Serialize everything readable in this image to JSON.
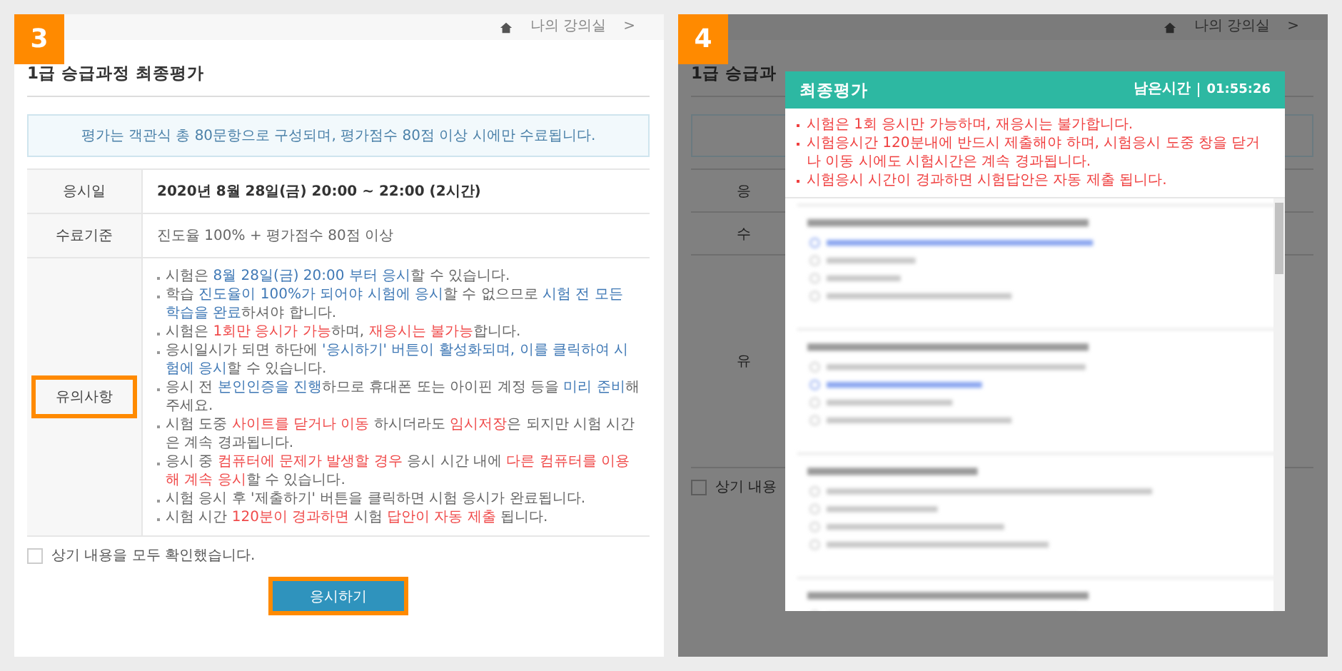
{
  "step_3": {
    "badge": "3",
    "breadcrumb": {
      "label": "나의 강의실",
      "separator": ">"
    },
    "title": "1급 승급과정 최종평가",
    "notice": "평가는 객관식 총 80문항으로 구성되며, 평가점수 80점 이상 시에만 수료됩니다.",
    "rows": [
      {
        "label": "응시일",
        "kind": "strong",
        "value": "2020년 8월 28일(금) 20:00 ~ 22:00 (2시간)"
      },
      {
        "label": "수료기준",
        "kind": "plain",
        "value": "진도율 100% + 평가점수 80점 이상"
      },
      {
        "label": "유의사항",
        "kind": "notes",
        "highlighted": true,
        "notes": [
          [
            {
              "text": "시험은 ",
              "kind": "normal"
            },
            {
              "text": "8월 28일(금) 20:00 부터 응시",
              "kind": "info"
            },
            {
              "text": "할 수 있습니다.",
              "kind": "normal"
            }
          ],
          [
            {
              "text": "학습 ",
              "kind": "normal"
            },
            {
              "text": "진도율이 100%가 되어야 시험에 응시",
              "kind": "info"
            },
            {
              "text": "할 수 없으므로 ",
              "kind": "normal"
            },
            {
              "text": "시험 전 모든 학습을 완료",
              "kind": "info"
            },
            {
              "text": "하셔야 합니다.",
              "kind": "normal"
            }
          ],
          [
            {
              "text": "시험은 ",
              "kind": "normal"
            },
            {
              "text": "1회만 응시가 가능",
              "kind": "warning"
            },
            {
              "text": "하며, ",
              "kind": "normal"
            },
            {
              "text": "재응시는 불가능",
              "kind": "warning"
            },
            {
              "text": "합니다.",
              "kind": "normal"
            }
          ],
          [
            {
              "text": "응시일시가 되면 하단에 ",
              "kind": "normal"
            },
            {
              "text": "'응시하기' 버튼이 활성화되며, 이를 클릭하여 시험에 응시",
              "kind": "info"
            },
            {
              "text": "할 수 있습니다.",
              "kind": "normal"
            }
          ],
          [
            {
              "text": "응시 전 ",
              "kind": "normal"
            },
            {
              "text": "본인인증을 진행",
              "kind": "info"
            },
            {
              "text": "하므로 휴대폰 또는 아이핀 계정 등을 ",
              "kind": "normal"
            },
            {
              "text": "미리 준비",
              "kind": "info"
            },
            {
              "text": "해 주세요.",
              "kind": "normal"
            }
          ],
          [
            {
              "text": "시험 도중 ",
              "kind": "normal"
            },
            {
              "text": "사이트를 닫거나 이동",
              "kind": "warning"
            },
            {
              "text": " 하시더라도 ",
              "kind": "normal"
            },
            {
              "text": "임시저장",
              "kind": "warning"
            },
            {
              "text": "은 되지만 시험 시간은 계속 경과됩니다.",
              "kind": "normal"
            }
          ],
          [
            {
              "text": "응시 중 ",
              "kind": "normal"
            },
            {
              "text": "컴퓨터에 문제가 발생할 경우",
              "kind": "warning"
            },
            {
              "text": " 응시 시간 내에 ",
              "kind": "normal"
            },
            {
              "text": "다른 컴퓨터를 이용해 계속 응시",
              "kind": "warning"
            },
            {
              "text": "할 수 있습니다.",
              "kind": "normal"
            }
          ],
          [
            {
              "text": "시험 응시 후 '제출하기' 버튼을 클릭하면 시험 응시가 완료됩니다.",
              "kind": "normal"
            }
          ],
          [
            {
              "text": "시험 시간 ",
              "kind": "normal"
            },
            {
              "text": "120분이 경과하면",
              "kind": "warning"
            },
            {
              "text": " 시험 ",
              "kind": "normal"
            },
            {
              "text": "답안이 자동 제출",
              "kind": "warning"
            },
            {
              "text": " 됩니다.",
              "kind": "normal"
            }
          ]
        ]
      }
    ],
    "confirm": {
      "label": "상기 내용을 모두 확인했습니다.",
      "checked": false
    },
    "start_button": {
      "label": "응시하기",
      "highlighted": true
    }
  },
  "step_4": {
    "badge": "4",
    "backdrop": {
      "breadcrumb": {
        "label": "나의 강의실",
        "separator": ">"
      },
      "title": "1급 승급과",
      "row_labels": [
        "응",
        "수",
        "유"
      ],
      "confirm": {
        "label": "상기 내용",
        "checked": false
      }
    },
    "modal": {
      "title": "최종평가",
      "timer_label": "남은시간",
      "timer": "01:55:26",
      "notices": [
        "시험은 1회 응시만 가능하며, 재응시는 불가합니다.",
        "시험응시간 120분내에 반드시 제출해야 하며, 시험응시 도중 창을 닫거나 이동 시에도 시험시간은 계속 경과됩니다.",
        "시험응시 시간이 경과하면 시험답안은 자동 제출 됩니다."
      ]
    }
  }
}
